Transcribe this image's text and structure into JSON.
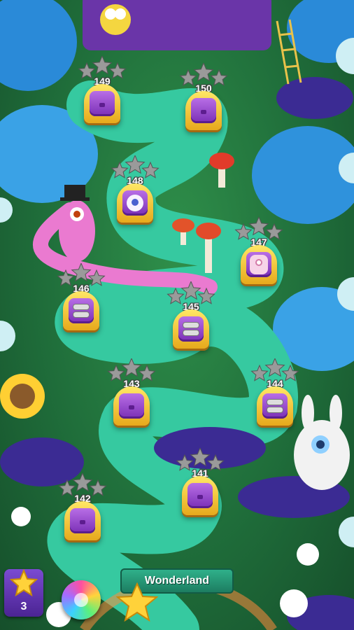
{
  "map": {
    "area_name": "Wonderland",
    "levels": [
      {
        "number": "149",
        "stars_earned": 0,
        "door": "chest"
      },
      {
        "number": "150",
        "stars_earned": 0,
        "door": "chest"
      },
      {
        "number": "148",
        "stars_earned": 0,
        "door": "face"
      },
      {
        "number": "147",
        "stars_earned": 0,
        "door": "monster"
      },
      {
        "number": "146",
        "stars_earned": 0,
        "door": "ovals"
      },
      {
        "number": "145",
        "stars_earned": 0,
        "door": "ovals"
      },
      {
        "number": "143",
        "stars_earned": 0,
        "door": "chest"
      },
      {
        "number": "144",
        "stars_earned": 0,
        "door": "ovals"
      },
      {
        "number": "141",
        "stars_earned": 0,
        "door": "chest"
      },
      {
        "number": "142",
        "stars_earned": 0,
        "door": "chest"
      }
    ]
  },
  "hud": {
    "star_count": "3",
    "colors": {
      "panel": "#5b2fb0",
      "banner": "#1f8f6b",
      "star": "#ffd23a",
      "rainbow_booster": "conic"
    }
  },
  "icons": [
    "star-icon",
    "rainbow-booster-icon",
    "padlock-chest-icon"
  ]
}
